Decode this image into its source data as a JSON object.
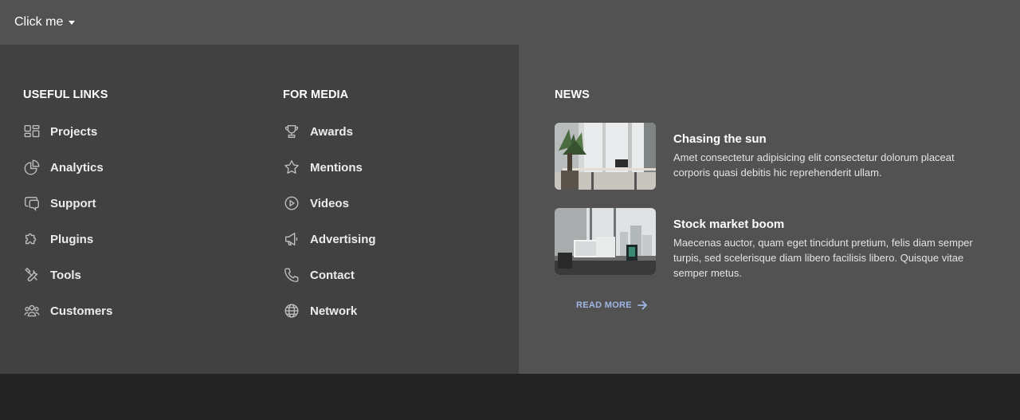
{
  "trigger": {
    "label": "Click me",
    "icon": "caret-down-icon"
  },
  "useful_links": {
    "heading": "USEFUL LINKS",
    "items": [
      {
        "label": "Projects",
        "icon": "projects-icon"
      },
      {
        "label": "Analytics",
        "icon": "pie-chart-icon"
      },
      {
        "label": "Support",
        "icon": "chat-icon"
      },
      {
        "label": "Plugins",
        "icon": "puzzle-icon"
      },
      {
        "label": "Tools",
        "icon": "tools-icon"
      },
      {
        "label": "Customers",
        "icon": "users-icon"
      }
    ]
  },
  "for_media": {
    "heading": "FOR MEDIA",
    "items": [
      {
        "label": "Awards",
        "icon": "trophy-icon"
      },
      {
        "label": "Mentions",
        "icon": "star-icon"
      },
      {
        "label": "Videos",
        "icon": "play-circle-icon"
      },
      {
        "label": "Advertising",
        "icon": "megaphone-icon"
      },
      {
        "label": "Contact",
        "icon": "phone-icon"
      },
      {
        "label": "Network",
        "icon": "globe-icon"
      }
    ]
  },
  "news": {
    "heading": "NEWS",
    "items": [
      {
        "title": "Chasing the sun",
        "text": "Amet consectetur adipisicing elit consectetur dolorum placeat corporis quasi debitis hic reprehenderit ullam."
      },
      {
        "title": "Stock market boom",
        "text": "Maecenas auctor, quam eget tincidunt pretium, felis diam semper turpis, sed scelerisque diam libero facilisis libero. Quisque vitae semper metus."
      }
    ],
    "read_more": "READ MORE"
  },
  "colors": {
    "topbar": "#525252",
    "menu_left": "#414141",
    "menu_right": "#525252",
    "page": "#232323",
    "link_accent": "#9fb6e4"
  }
}
